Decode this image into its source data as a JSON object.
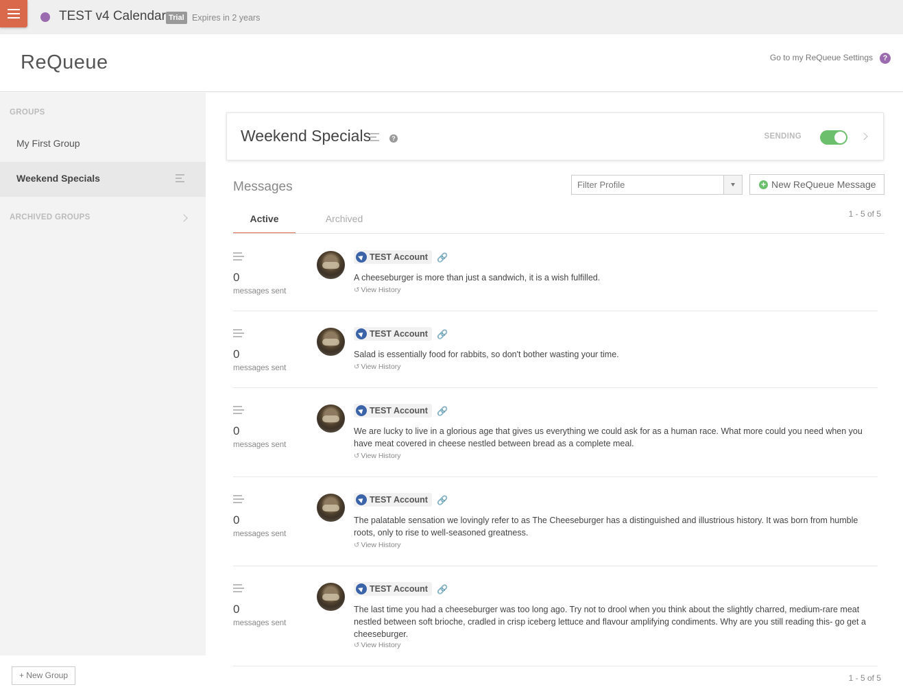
{
  "topbar": {
    "calendar_name": "TEST v4 Calendar",
    "calendar_color": "#9b6bb0",
    "trial_badge": "Trial",
    "expires_text": "Expires in 2 years"
  },
  "header": {
    "logo": "ReQueue",
    "settings_link": "Go to my ReQueue Settings",
    "help_glyph": "?"
  },
  "sidebar": {
    "groups_heading": "GROUPS",
    "groups": [
      {
        "label": "My First Group"
      },
      {
        "label": "Weekend Specials"
      }
    ],
    "archived_heading": "ARCHIVED GROUPS",
    "new_group_label": "+ New Group"
  },
  "group": {
    "title": "Weekend Specials",
    "help_glyph": "?",
    "sending_label": "SENDING",
    "sending_on": true
  },
  "messages": {
    "title": "Messages",
    "filter_placeholder": "Filter Profile",
    "new_message_label": "New ReQueue Message",
    "tabs": [
      {
        "label": "Active"
      },
      {
        "label": "Archived"
      }
    ],
    "count_label": "1 - 5 of 5",
    "items": [
      {
        "sent": "0",
        "sent_label": "messages sent",
        "account": "TEST Account",
        "text": "A cheeseburger is more than just a sandwich, it is a wish fulfilled.",
        "history": "View History"
      },
      {
        "sent": "0",
        "sent_label": "messages sent",
        "account": "TEST Account",
        "text": "Salad is essentially food for rabbits, so don't bother wasting your time.",
        "history": "View History"
      },
      {
        "sent": "0",
        "sent_label": "messages sent",
        "account": "TEST Account",
        "text": "We are lucky to live in a glorious age that gives us everything we could ask for as a human race. What more could you need when you have meat covered in cheese nestled between bread as a complete meal.",
        "history": "View History"
      },
      {
        "sent": "0",
        "sent_label": "messages sent",
        "account": "TEST Account",
        "text": "The palatable sensation we lovingly refer to as The Cheeseburger has a distinguished and illustrious history. It was born from humble roots, only to rise to well-seasoned greatness.",
        "history": "View History"
      },
      {
        "sent": "0",
        "sent_label": "messages sent",
        "account": "TEST Account",
        "text": "The last time you had a cheeseburger was too long ago. Try not to drool when you think about the slightly charred, medium-rare meat nestled between soft brioche, cradled in crisp iceberg lettuce and flavour amplifying condiments. Why are you still reading this- go get a cheeseburger.",
        "history": "View History"
      }
    ]
  },
  "colors": {
    "accent": "#d9694a",
    "toggle_on": "#6cbf6c",
    "twitter_blue": "#3b63a8",
    "help_purple": "#9b6bb0"
  },
  "icons": [
    "hamburger-menu-icon",
    "help-icon",
    "queue-lines-icon",
    "chevron-right-icon",
    "plus-circle-icon",
    "link-icon",
    "history-icon",
    "twitter-icon"
  ]
}
